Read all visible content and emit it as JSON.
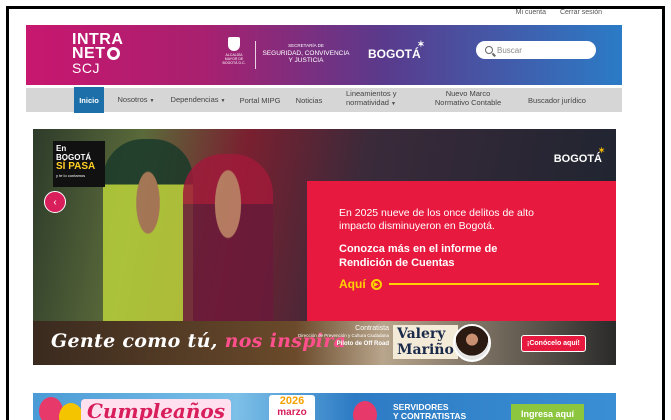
{
  "toplinks": {
    "account": "Mi cuenta",
    "logout": "Cerrar sesión"
  },
  "header": {
    "logo_line1": "INTRA",
    "logo_line2": "NET",
    "logo_line3": "SCJ",
    "crest_text": "ALCALDÍA MAYOR DE BOGOTÁ D.C.",
    "secretaria_small": "SECRETARÍA DE",
    "secretaria_name": "SEGURIDAD, CONVIVENCIA Y JUSTICIA",
    "city": "BOGOTÁ",
    "search_placeholder": "Buscar"
  },
  "nav": {
    "items": [
      {
        "label": "Inicio"
      },
      {
        "label": "Nosotros"
      },
      {
        "label": "Dependencias"
      },
      {
        "label": "Portal MIPG"
      },
      {
        "label": "Noticias"
      },
      {
        "label": "Lineamientos y normatividad"
      },
      {
        "label": "Nuevo Marco Normativo Contable"
      },
      {
        "label": "Buscador jurídico"
      }
    ],
    "caret": "▼"
  },
  "hero": {
    "badge_line1": "En BOGOTÁ",
    "badge_line2": "SÍ PASA",
    "badge_line3": "y te lo contamos",
    "city": "BOGOTÁ",
    "text1": "En 2025 nueve de los once delitos de alto impacto disminuyeron en Bogotá.",
    "text2": "Conozca más en el informe de Rendición de Cuentas",
    "cta": "Aquí",
    "prev_arrow": "‹",
    "next_arrow": "›"
  },
  "banner2": {
    "slogan_part1": "Gente como tú,",
    "slogan_part2": "nos inspira",
    "role": "Contratista",
    "dept": "Dirección de Prevención y Cultura Ciudadana",
    "title": "Piloto de Off Road",
    "name_line1": "Valery",
    "name_line2": "Mariño",
    "cta": "¡Conócelo aquí!"
  },
  "banner3": {
    "title": "Cumpleaños",
    "year": "2026",
    "month": "marzo",
    "serv_line1": "SERVIDORES",
    "serv_line2": "Y CONTRATISTAS",
    "cta": "Ingresa aquí"
  },
  "colors": {
    "magenta": "#c8176f",
    "nav_active": "#1c6fa8",
    "hero_red": "#e8193f",
    "yellow": "#ffd200",
    "green_cta": "#8cc63f"
  }
}
